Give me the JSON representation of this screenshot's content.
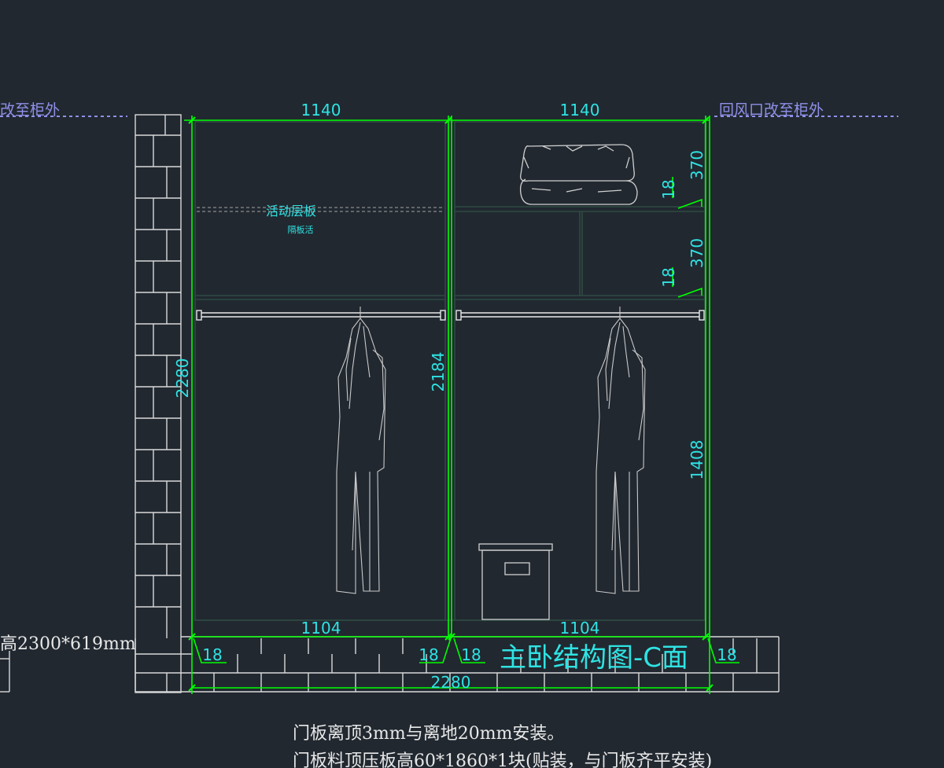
{
  "canvas": {
    "background": "#212830"
  },
  "colors": {
    "dimension": "#00ff00",
    "text": "#2fe3e3",
    "note": "#8f8fe8",
    "line": "#d9d9d9",
    "inner": "#2f4a42"
  },
  "notes": {
    "left": "改至柜外",
    "right": "回风口改至柜外"
  },
  "dims": {
    "top_left": "1140",
    "top_right": "1140",
    "bottom_left": "1104",
    "bottom_right": "1104",
    "total_width": "2280",
    "height": "2280",
    "inner_height": "2184",
    "hang_height": "1408",
    "shelf1": "370",
    "shelf2": "370",
    "thick_a": "18",
    "thick_b": "18",
    "thick_c": "18",
    "thick_d": "18",
    "thick_e": "18",
    "thick_f": "18"
  },
  "labels": {
    "movable_shelf": "活动层板",
    "small_note": "隔板活",
    "title": "主卧结构图-C面",
    "side_spec": "高2300*619mm"
  },
  "footer": {
    "line1": "门板离顶3mm与离地20mm安装。",
    "line2": "门板料顶压板高60*1860*1块(贴装，与门板齐平安装)"
  },
  "icons": [
    "brick-wall-icon",
    "hanging-coat-icon",
    "folded-bedding-icon",
    "storage-box-icon",
    "hanging-rod-icon"
  ]
}
